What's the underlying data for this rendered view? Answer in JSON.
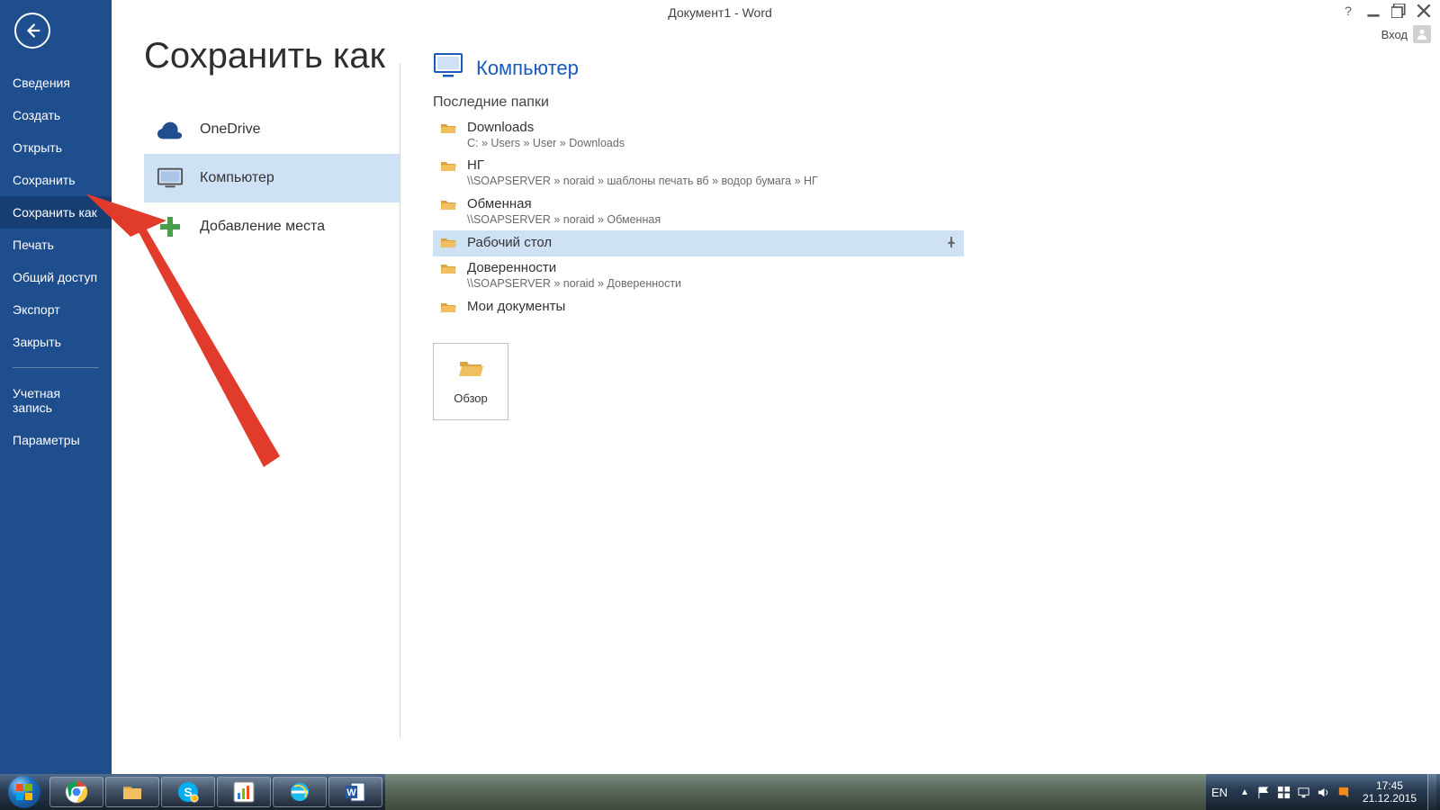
{
  "window": {
    "title": "Документ1 - Word",
    "signin_label": "Вход"
  },
  "nav": {
    "items": [
      {
        "id": "info",
        "label": "Сведения"
      },
      {
        "id": "create",
        "label": "Создать"
      },
      {
        "id": "open",
        "label": "Открыть"
      },
      {
        "id": "save",
        "label": "Сохранить"
      },
      {
        "id": "saveas",
        "label": "Сохранить как",
        "selected": true
      },
      {
        "id": "print",
        "label": "Печать"
      },
      {
        "id": "share",
        "label": "Общий доступ"
      },
      {
        "id": "export",
        "label": "Экспорт"
      },
      {
        "id": "close",
        "label": "Закрыть"
      }
    ],
    "account_label": "Учетная запись",
    "options_label": "Параметры"
  },
  "page": {
    "title": "Сохранить как"
  },
  "places": {
    "onedrive": "OneDrive",
    "computer": "Компьютер",
    "addplace": "Добавление места"
  },
  "panel": {
    "title": "Компьютер",
    "recent_label": "Последние папки",
    "folders": [
      {
        "name": "Downloads",
        "path": "C: » Users » User » Downloads"
      },
      {
        "name": "НГ",
        "path": "\\\\SOAPSERVER » noraid » шаблоны печать вб » водор бумага » НГ"
      },
      {
        "name": "Обменная",
        "path": "\\\\SOAPSERVER » noraid » Обменная"
      },
      {
        "name": "Рабочий стол",
        "path": "",
        "highlight": true
      },
      {
        "name": "Доверенности",
        "path": "\\\\SOAPSERVER » noraid » Доверенности"
      },
      {
        "name": "Мои документы",
        "path": ""
      }
    ],
    "browse_label": "Обзор"
  },
  "taskbar": {
    "language": "EN",
    "time": "17:45",
    "date": "21.12.2015"
  }
}
